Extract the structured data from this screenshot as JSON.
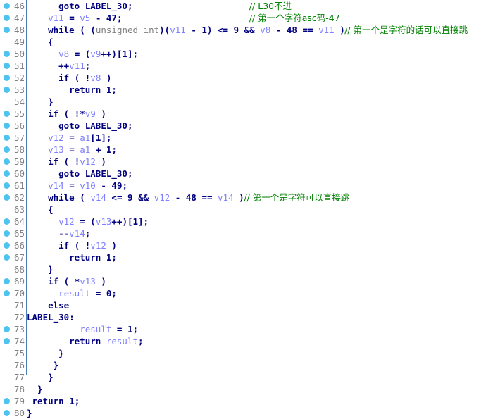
{
  "view": {
    "name": "pseudocode-listing",
    "description": "Decompiler pseudocode listing with breakpoint gutter",
    "first_line": 46,
    "last_line": 80,
    "accent_color": "#4fc3f0",
    "gutter_rule_color": "#4a7ebb",
    "keyword_color": "#00007f",
    "variable_color": "#8080ff",
    "type_color": "#808080",
    "comment_color": "#008000",
    "lineno_color": "#808080",
    "background_color": "#ffffff"
  },
  "lines": [
    {
      "n": "46",
      "bp": true,
      "indent": 6,
      "code": "goto LABEL_30;",
      "comment": "// L30不进",
      "comment_col": 42
    },
    {
      "n": "47",
      "bp": true,
      "indent": 4,
      "code": "v11 = v5 - 47;",
      "comment": "// 第一个字符asc码-47",
      "comment_col": 42
    },
    {
      "n": "48",
      "bp": true,
      "indent": 4,
      "code": "while ( (unsigned int)(v11 - 1) <= 9 && v8 - 48 == v11 )",
      "comment": "// 第一个是字符的话可以直接跳",
      "comment_col": 0
    },
    {
      "n": "49",
      "bp": false,
      "indent": 4,
      "code": "{",
      "comment": "",
      "comment_col": 0
    },
    {
      "n": "50",
      "bp": true,
      "indent": 6,
      "code": "v8 = (v9++)[1];",
      "comment": "",
      "comment_col": 0
    },
    {
      "n": "51",
      "bp": true,
      "indent": 6,
      "code": "++v11;",
      "comment": "",
      "comment_col": 0
    },
    {
      "n": "52",
      "bp": true,
      "indent": 6,
      "code": "if ( !v8 )",
      "comment": "",
      "comment_col": 0
    },
    {
      "n": "53",
      "bp": true,
      "indent": 8,
      "code": "return 1;",
      "comment": "",
      "comment_col": 0
    },
    {
      "n": "54",
      "bp": false,
      "indent": 4,
      "code": "}",
      "comment": "",
      "comment_col": 0
    },
    {
      "n": "55",
      "bp": true,
      "indent": 4,
      "code": "if ( !*v9 )",
      "comment": "",
      "comment_col": 0
    },
    {
      "n": "56",
      "bp": true,
      "indent": 6,
      "code": "goto LABEL_30;",
      "comment": "",
      "comment_col": 0
    },
    {
      "n": "57",
      "bp": true,
      "indent": 4,
      "code": "v12 = a1[1];",
      "comment": "",
      "comment_col": 0
    },
    {
      "n": "58",
      "bp": true,
      "indent": 4,
      "code": "v13 = a1 + 1;",
      "comment": "",
      "comment_col": 0
    },
    {
      "n": "59",
      "bp": true,
      "indent": 4,
      "code": "if ( !v12 )",
      "comment": "",
      "comment_col": 0
    },
    {
      "n": "60",
      "bp": true,
      "indent": 6,
      "code": "goto LABEL_30;",
      "comment": "",
      "comment_col": 0
    },
    {
      "n": "61",
      "bp": true,
      "indent": 4,
      "code": "v14 = v10 - 49;",
      "comment": "",
      "comment_col": 0
    },
    {
      "n": "62",
      "bp": true,
      "indent": 4,
      "code": "while ( v14 <= 9 && v12 - 48 == v14 )",
      "comment": "// 第一个是字符可以直接跳",
      "comment_col": 0
    },
    {
      "n": "63",
      "bp": false,
      "indent": 4,
      "code": "{",
      "comment": "",
      "comment_col": 0
    },
    {
      "n": "64",
      "bp": true,
      "indent": 6,
      "code": "v12 = (v13++)[1];",
      "comment": "",
      "comment_col": 0
    },
    {
      "n": "65",
      "bp": true,
      "indent": 6,
      "code": "--v14;",
      "comment": "",
      "comment_col": 0
    },
    {
      "n": "66",
      "bp": true,
      "indent": 6,
      "code": "if ( !v12 )",
      "comment": "",
      "comment_col": 0
    },
    {
      "n": "67",
      "bp": true,
      "indent": 8,
      "code": "return 1;",
      "comment": "",
      "comment_col": 0
    },
    {
      "n": "68",
      "bp": false,
      "indent": 4,
      "code": "}",
      "comment": "",
      "comment_col": 0
    },
    {
      "n": "69",
      "bp": true,
      "indent": 4,
      "code": "if ( *v13 )",
      "comment": "",
      "comment_col": 0
    },
    {
      "n": "70",
      "bp": true,
      "indent": 6,
      "code": "result = 0;",
      "comment": "",
      "comment_col": 0
    },
    {
      "n": "71",
      "bp": false,
      "indent": 4,
      "code": "else",
      "comment": "",
      "comment_col": 0
    },
    {
      "n": "72",
      "bp": false,
      "indent": 0,
      "code": "LABEL_30:",
      "comment": "",
      "comment_col": 0
    },
    {
      "n": "73",
      "bp": true,
      "indent": 10,
      "code": "result = 1;",
      "comment": "",
      "comment_col": 0
    },
    {
      "n": "74",
      "bp": true,
      "indent": 8,
      "code": "return result;",
      "comment": "",
      "comment_col": 0
    },
    {
      "n": "75",
      "bp": false,
      "indent": 6,
      "code": "}",
      "comment": "",
      "comment_col": 0
    },
    {
      "n": "76",
      "bp": false,
      "indent": 5,
      "code": "}",
      "comment": "",
      "comment_col": 0
    },
    {
      "n": "77",
      "bp": false,
      "indent": 4,
      "code": "}",
      "comment": "",
      "comment_col": 0
    },
    {
      "n": "78",
      "bp": false,
      "indent": 2,
      "code": "}",
      "comment": "",
      "comment_col": 0
    },
    {
      "n": "79",
      "bp": true,
      "indent": 1,
      "code": "return 1;",
      "comment": "",
      "comment_col": 0
    },
    {
      "n": "80",
      "bp": true,
      "indent": 0,
      "code": "}",
      "comment": "",
      "comment_col": 0
    }
  ]
}
